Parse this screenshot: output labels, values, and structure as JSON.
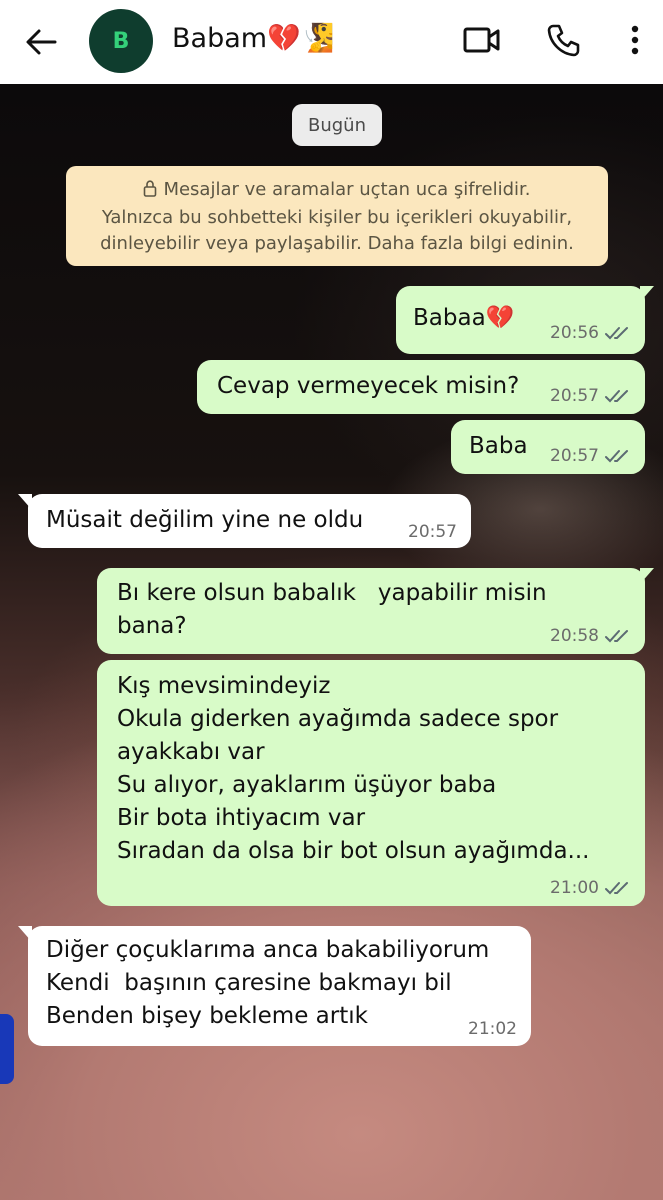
{
  "header": {
    "avatar_letter": "B",
    "contact_name": "Babam💔🧏",
    "icons": [
      "back-arrow-icon",
      "video-call-icon",
      "phone-call-icon",
      "more-options-icon"
    ]
  },
  "chat": {
    "date_chip": "Bugün",
    "encryption_notice": {
      "line1": "Mesajlar ve aramalar uçtan uca şifrelidir.",
      "line2": "Yalnızca bu sohbetteki kişiler bu içerikleri okuyabilir,",
      "line3": "dinleyebilir veya paylaşabilir. Daha fazla bilgi edinin."
    },
    "messages": [
      {
        "direction": "out",
        "text": "Babaa💔",
        "time": "20:56",
        "status": "read"
      },
      {
        "direction": "out",
        "text": "Cevap vermeyecek misin?",
        "time": "20:57",
        "status": "read"
      },
      {
        "direction": "out",
        "text": "Baba",
        "time": "20:57",
        "status": "read"
      },
      {
        "direction": "in",
        "text": "Müsait değilim yine ne oldu",
        "time": "20:57"
      },
      {
        "direction": "out",
        "text": "Bı kere olsun babalık   yapabilir misin\nbana?",
        "time": "20:58",
        "status": "read"
      },
      {
        "direction": "out",
        "text": "Kış mevsimindeyiz\nOkula giderken ayağımda sadece spor\nayakkabı var\nSu alıyor, ayaklarım üşüyor baba\nBir bota ihtiyacım var\nSıradan da olsa bir bot olsun ayağımda...",
        "time": "21:00",
        "status": "read"
      },
      {
        "direction": "in",
        "text": "Diğer çoçuklarıma anca bakabiliyorum\nKendi  başının çaresine bakmayı bil\nBenden bişey bekleme artık",
        "time": "21:02"
      }
    ]
  },
  "colors": {
    "outgoing_bubble": "#d8fbc8",
    "incoming_bubble": "#ffffff",
    "read_ticks": "#5c6b73",
    "notice_bg": "#fbe7be",
    "avatar_bg": "#0f3d2e",
    "avatar_letter": "#34d17a"
  }
}
